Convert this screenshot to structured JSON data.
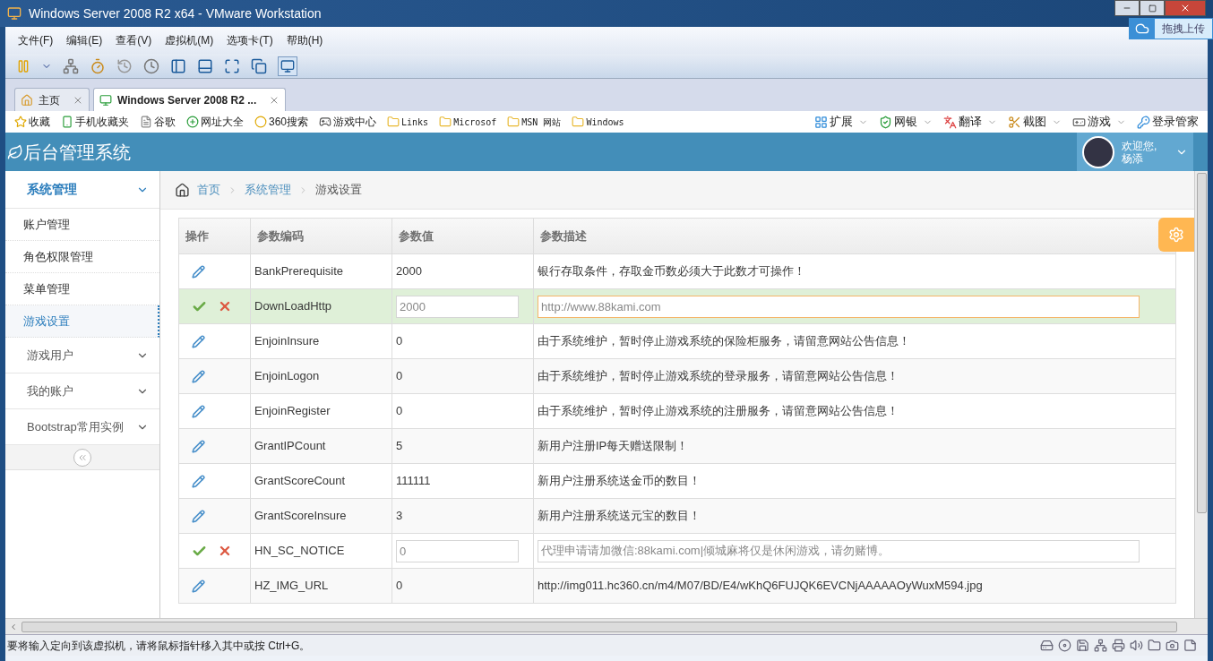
{
  "window": {
    "title": "Windows Server 2008 R2 x64 - VMware Workstation"
  },
  "menu": [
    "文件(F)",
    "编辑(E)",
    "查看(V)",
    "虚拟机(M)",
    "选项卡(T)",
    "帮助(H)"
  ],
  "upload_badge": "拖拽上传",
  "vm_tabs": [
    {
      "label": "主页",
      "selected": false
    },
    {
      "label": "Windows Server 2008 R2 ...",
      "selected": true
    }
  ],
  "bookmarks": [
    "收藏",
    "手机收藏夹",
    "谷歌",
    "网址大全",
    "360搜索",
    "游戏中心",
    "Links",
    "Microsof",
    "MSN 网站",
    "Windows"
  ],
  "browser_tools": [
    "扩展",
    "网银",
    "翻译",
    "截图",
    "游戏",
    "登录管家"
  ],
  "app": {
    "brand": "后台管理系统",
    "greeting": "欢迎您,",
    "user_name": "杨添"
  },
  "sidebar": [
    {
      "label": "系统管理",
      "expanded": true,
      "children": [
        {
          "label": "账户管理",
          "selected": false
        },
        {
          "label": "角色权限管理",
          "selected": false
        },
        {
          "label": "菜单管理",
          "selected": false
        },
        {
          "label": "游戏设置",
          "selected": true
        }
      ]
    },
    {
      "label": "游戏用户",
      "expanded": false
    },
    {
      "label": "我的账户",
      "expanded": false
    },
    {
      "label": "Bootstrap常用实例",
      "expanded": false
    }
  ],
  "breadcrumb": [
    "首页",
    "系统管理",
    "游戏设置"
  ],
  "table": {
    "columns": [
      "操作",
      "参数编码",
      "参数值",
      "参数描述"
    ],
    "rows": [
      {
        "kind": "view",
        "selected": false,
        "code": "BankPrerequisite",
        "value": "2000",
        "description": "银行存取条件，存取金币数必须大于此数才可操作！"
      },
      {
        "kind": "edit",
        "selected": true,
        "code": "DownLoadHttp",
        "value": "2000",
        "description": "http://www.88kami.com"
      },
      {
        "kind": "view",
        "selected": false,
        "code": "EnjoinInsure",
        "value": "0",
        "description": "由于系统维护，暂时停止游戏系统的保险柜服务，请留意网站公告信息！"
      },
      {
        "kind": "view",
        "selected": false,
        "code": "EnjoinLogon",
        "value": "0",
        "description": "由于系统维护，暂时停止游戏系统的登录服务，请留意网站公告信息！"
      },
      {
        "kind": "view",
        "selected": false,
        "code": "EnjoinRegister",
        "value": "0",
        "description": "由于系统维护，暂时停止游戏系统的注册服务，请留意网站公告信息！"
      },
      {
        "kind": "view",
        "selected": false,
        "code": "GrantIPCount",
        "value": "5",
        "description": "新用户注册IP每天赠送限制！"
      },
      {
        "kind": "view",
        "selected": false,
        "code": "GrantScoreCount",
        "value": "111111",
        "description": "新用户注册系统送金币的数目！"
      },
      {
        "kind": "view",
        "selected": false,
        "code": "GrantScoreInsure",
        "value": "3",
        "description": "新用户注册系统送元宝的数目！"
      },
      {
        "kind": "edit",
        "selected": false,
        "code": "HN_SC_NOTICE",
        "value": "0",
        "description": "代理申请请加微信:88kami.com|倾城麻将仅是休闲游戏，请勿赌博。"
      },
      {
        "kind": "view",
        "selected": false,
        "code": "HZ_IMG_URL",
        "value": "0",
        "description": "http://img011.hc360.cn/m4/M07/BD/E4/wKhQ6FUJQK6EVCNjAAAAAOyWuxM594.jpg"
      }
    ]
  },
  "status_bar": "要将输入定向到该虚拟机，请将鼠标指针移入其中或按 Ctrl+G。"
}
